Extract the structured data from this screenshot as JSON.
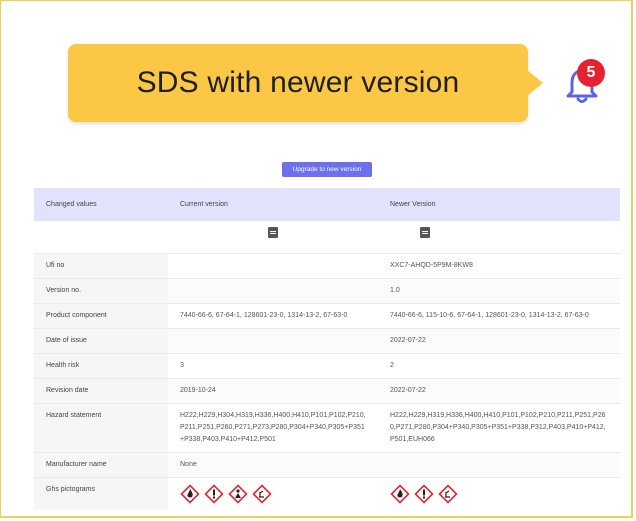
{
  "banner": {
    "title": "SDS with newer version",
    "notification_count": "5"
  },
  "upgrade_button_label": "Upgrade to new version",
  "colors": {
    "banner": "#fbc744",
    "badge": "#e8212f",
    "bell": "#5a63e6",
    "button": "#6b6ff0",
    "table_header": "#e1e2fb",
    "ghs_border": "#e8212f"
  },
  "table": {
    "headers": [
      "Changed values",
      "Current version",
      "Newer Version"
    ],
    "rows": [
      {
        "label": "Ufi no",
        "current": "",
        "newer": "XXC7-AHQD-5P9M-8KW8"
      },
      {
        "label": "Version no.",
        "current": "",
        "newer": "1.0"
      },
      {
        "label": "Product component",
        "current": "7440-66-6, 67-64-1, 128601-23-0, 1314-13-2, 67-63-0",
        "newer": "7440-66-6, 115-10-6, 67-64-1, 128601-23-0, 1314-13-2, 67-63-0"
      },
      {
        "label": "Date of issue",
        "current": "",
        "newer": "2022-07-22"
      },
      {
        "label": "Health risk",
        "current": "3",
        "newer": "2"
      },
      {
        "label": "Revision date",
        "current": "2019-10-24",
        "newer": "2022-07-22"
      },
      {
        "label": "Hazard statement",
        "current": "H222,H229,H304,H319,H336,H400,H410,P101,P102,P210,P211,P251,P260,P271,P273,P280,P304+P340,P305+P351+P338,P403,P410+P412,P501",
        "newer": "H222,H229,H319,H336,H400,H410,P101,P102,P210,P211,P251,P260,P271,P280,P304+P340,P305+P351+P338,P312,P403,P410+P412,P501,EUH066"
      },
      {
        "label": "Manufacturer name",
        "current": "None",
        "newer": ""
      },
      {
        "label": "Ghs pictograms",
        "current": "",
        "newer": ""
      }
    ],
    "ghs_current": [
      "flame-icon",
      "exclamation-icon",
      "health-hazard-icon",
      "environment-icon"
    ],
    "ghs_newer": [
      "flame-icon",
      "exclamation-icon",
      "environment-icon"
    ]
  }
}
